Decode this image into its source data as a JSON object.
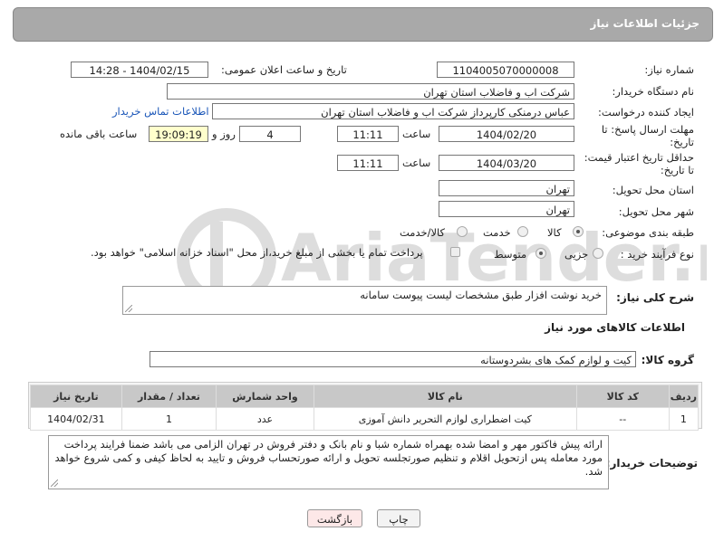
{
  "header": {
    "title": "جزئیات اطلاعات نیاز"
  },
  "form": {
    "need_number_label": "شماره نیاز:",
    "need_number": "1104005070000008",
    "announce_label": "تاریخ و ساعت اعلان عمومی:",
    "announce_value": "1404/02/15 - 14:28",
    "buyer_org_label": "نام دستگاه خریدار:",
    "buyer_org": "شرکت اب و فاضلاب استان تهران",
    "creator_label": "ایجاد کننده درخواست:",
    "creator": "عباس درمنکی کارپرداز شرکت اب و فاضلاب استان تهران",
    "contact_link": "اطلاعات تماس خریدار",
    "deadline_label": "مهلت ارسال پاسخ: تا تاریخ:",
    "deadline_date": "1404/02/20",
    "time_label": "ساعت",
    "deadline_time": "11:11",
    "days_value": "4",
    "days_label": "روز و",
    "remaining_time": "19:09:19",
    "remaining_label": "ساعت باقی مانده",
    "validity_label": "حداقل تاریخ اعتبار قیمت: تا تاریخ:",
    "validity_date": "1404/03/20",
    "validity_time": "11:11",
    "province_label": "استان محل تحویل:",
    "province": "تهران",
    "city_label": "شهر محل تحویل:",
    "city": "تهران",
    "category_label": "طبقه بندی موضوعی:",
    "category_options": [
      "کالا",
      "خدمت",
      "کالا/خدمت"
    ],
    "category_selected": "کالا",
    "process_label": "نوع فرآیند خرید :",
    "process_options": [
      "جزیی",
      "متوسط"
    ],
    "process_selected": "متوسط",
    "payment_note": "پرداخت تمام یا بخشی از مبلغ خرید،از محل \"اسناد خزانه اسلامی\" خواهد بود."
  },
  "description": {
    "label": "شرح کلی نیاز:",
    "text": "خرید نوشت افزار طبق مشخصات لیست پیوست سامانه"
  },
  "goods": {
    "section_title": "اطلاعات کالاهای مورد نیاز",
    "group_label": "گروه کالا:",
    "group_value": "کیت و لوازم کمک های بشردوستانه",
    "columns": [
      "ردیف",
      "کد کالا",
      "نام کالا",
      "واحد شمارش",
      "تعداد / مقدار",
      "تاریخ نیاز"
    ],
    "rows": [
      {
        "row": "1",
        "code": "--",
        "name": "کیت اضطراری لوازم التحریر دانش آموزی",
        "unit": "عدد",
        "qty": "1",
        "date": "1404/02/31"
      }
    ]
  },
  "buyer_notes": {
    "label": "توضیحات خریدار:",
    "text": "ارائه پیش فاکتور مهر و امضا شده بهمراه شماره شبا و نام بانک و دفتر فروش در تهران الزامی می باشد ضمنا فرایند پرداخت مورد معامله پس ازتحویل اقلام  و تنظیم  صورتجلسه تحویل و ارائه صورتحساب فروش و تایید به لحاظ کیفی و کمی شروع خواهد شد."
  },
  "buttons": {
    "print": "چاپ",
    "back": "بازگشت"
  },
  "colors": {
    "header_bg": "#a9a9a9",
    "link": "#1a56b8",
    "back_button_bg": "#fde8e8",
    "yellow_field": "#ffffcc"
  },
  "watermark": {
    "brand": "AriaTender.net"
  }
}
